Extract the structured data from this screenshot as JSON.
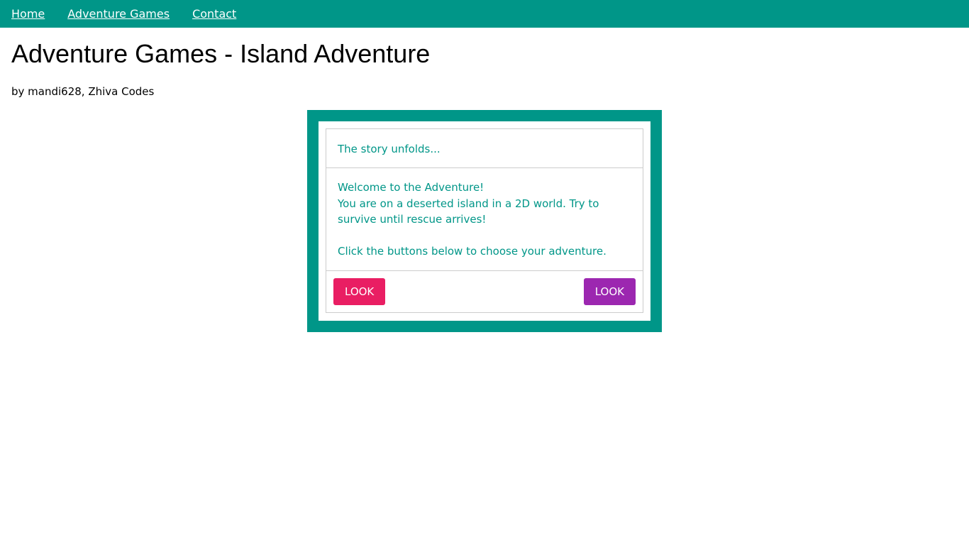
{
  "nav": {
    "items": [
      {
        "label": "Home"
      },
      {
        "label": "Adventure Games"
      },
      {
        "label": "Contact"
      }
    ]
  },
  "page": {
    "title": "Adventure Games - Island Adventure",
    "byline": "by mandi628, Zhiva Codes"
  },
  "game": {
    "header": "The story unfolds...",
    "story": {
      "line1": "Welcome to the Adventure!",
      "line2": "You are on a deserted island in a 2D world. Try to survive until rescue arrives!",
      "line3": "Click the buttons below to choose your adventure."
    },
    "buttons": {
      "left_label": "LOOK",
      "right_label": "LOOK"
    }
  },
  "colors": {
    "nav_bg": "#009688",
    "frame": "#009688",
    "story_text": "#009688",
    "button_left": "#e91e63",
    "button_right": "#9c27b0"
  }
}
